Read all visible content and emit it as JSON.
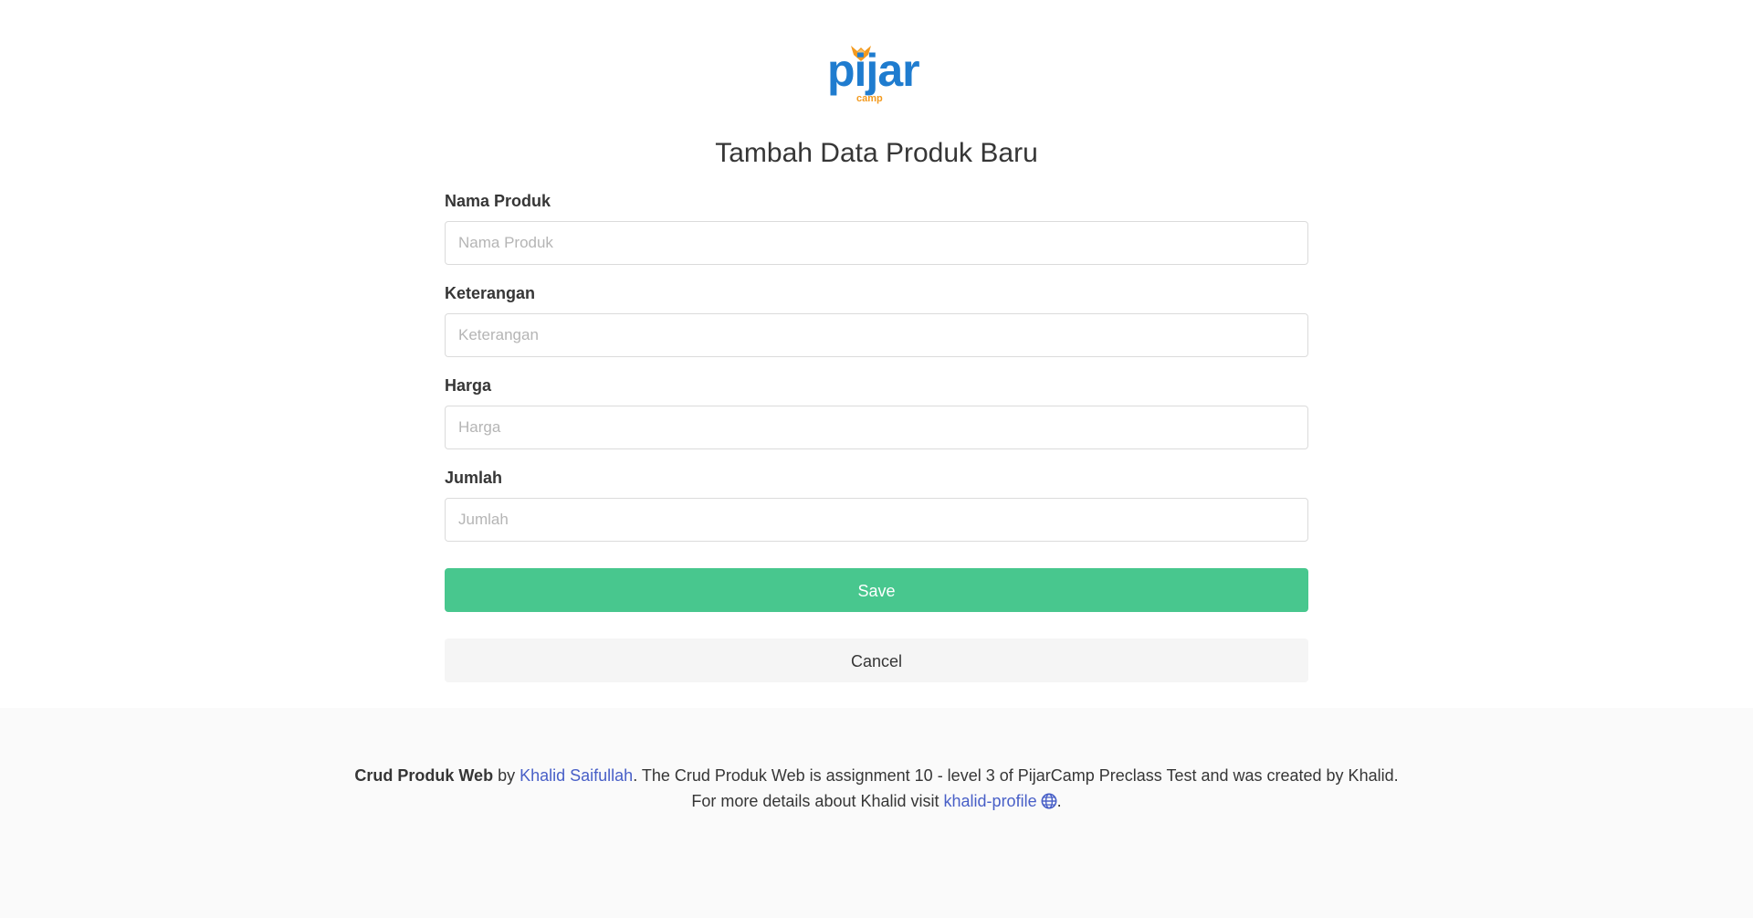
{
  "logo": {
    "word": "pijar",
    "sub": "camp"
  },
  "page": {
    "title": "Tambah Data Produk Baru"
  },
  "form": {
    "fields": [
      {
        "label": "Nama Produk",
        "placeholder": "Nama Produk",
        "value": ""
      },
      {
        "label": "Keterangan",
        "placeholder": "Keterangan",
        "value": ""
      },
      {
        "label": "Harga",
        "placeholder": "Harga",
        "value": ""
      },
      {
        "label": "Jumlah",
        "placeholder": "Jumlah",
        "value": ""
      }
    ],
    "save_label": "Save",
    "cancel_label": "Cancel"
  },
  "footer": {
    "app_name": "Crud Produk Web",
    "by": " by ",
    "author_link": "Khalid Saifullah",
    "description": ". The Crud Produk Web is assignment 10 - level 3 of PijarCamp Preclass Test and was created by Khalid.",
    "line2_prefix": "For more details about Khalid visit ",
    "profile_link": "khalid-profile",
    "line2_suffix": "."
  },
  "colors": {
    "primary_blue": "#1f7ccf",
    "accent_orange": "#f39a1e",
    "save_green": "#48c78e",
    "cancel_gray": "#f5f5f5",
    "link_blue": "#485fc7",
    "footer_bg": "#fafafa"
  },
  "icons": {
    "logo_mark": "fox-flame-icon",
    "profile": "globe-icon"
  }
}
